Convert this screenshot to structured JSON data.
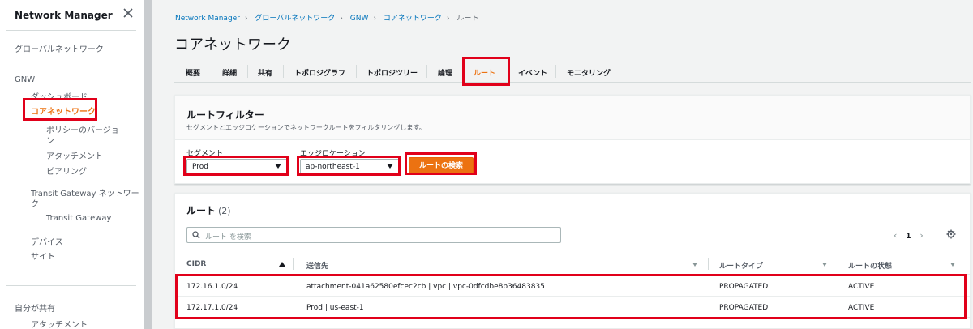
{
  "sidebar": {
    "title": "Network Manager",
    "global_networks": "グローバルネットワーク",
    "gnw": "GNW",
    "dashboard": "ダッシュボード",
    "core_network": "コアネットワーク",
    "policy_versions_line1": "ポリシーのバージョ",
    "policy_versions_line2": "ン",
    "attachments": "アタッチメント",
    "peering": "ピアリング",
    "tgw_network_line1": "Transit Gateway ネットワー",
    "tgw_network_line2": "ク",
    "transit_gateway": "Transit Gateway",
    "devices": "デバイス",
    "sites": "サイト",
    "shared_with_me": "自分が共有",
    "shared_attachments": "アタッチメント"
  },
  "breadcrumb": [
    "Network Manager",
    "グローバルネットワーク",
    "GNW",
    "コアネットワーク",
    "ルート"
  ],
  "page_title": "コアネットワーク",
  "tabs": [
    "概要",
    "詳細",
    "共有",
    "トポロジグラフ",
    "トポロジツリー",
    "論理",
    "ルート",
    "イベント",
    "モニタリング"
  ],
  "filter": {
    "title": "ルートフィルター",
    "description": "セグメントとエッジロケーションでネットワークルートをフィルタリングします。",
    "segment_label": "セグメント",
    "segment_value": "Prod",
    "edge_label": "エッジロケーション",
    "edge_value": "ap-northeast-1",
    "search_button": "ルートの検索"
  },
  "routes": {
    "title": "ルート",
    "count": "(2)",
    "search_placeholder": "ルート を検索",
    "page": "1",
    "columns": [
      "CIDR",
      "送信先",
      "ルートタイプ",
      "ルートの状態"
    ],
    "rows": [
      {
        "cidr": "172.16.1.0/24",
        "destination": "attachment-041a62580efcec2cb | vpc | vpc-0dfcdbe8b36483835",
        "type": "PROPAGATED",
        "state": "ACTIVE"
      },
      {
        "cidr": "172.17.1.0/24",
        "destination": "Prod | us-east-1",
        "type": "PROPAGATED",
        "state": "ACTIVE"
      }
    ]
  },
  "colors": {
    "accent": "#ec7211",
    "highlight": "#e1001a",
    "link": "#0073bb"
  }
}
